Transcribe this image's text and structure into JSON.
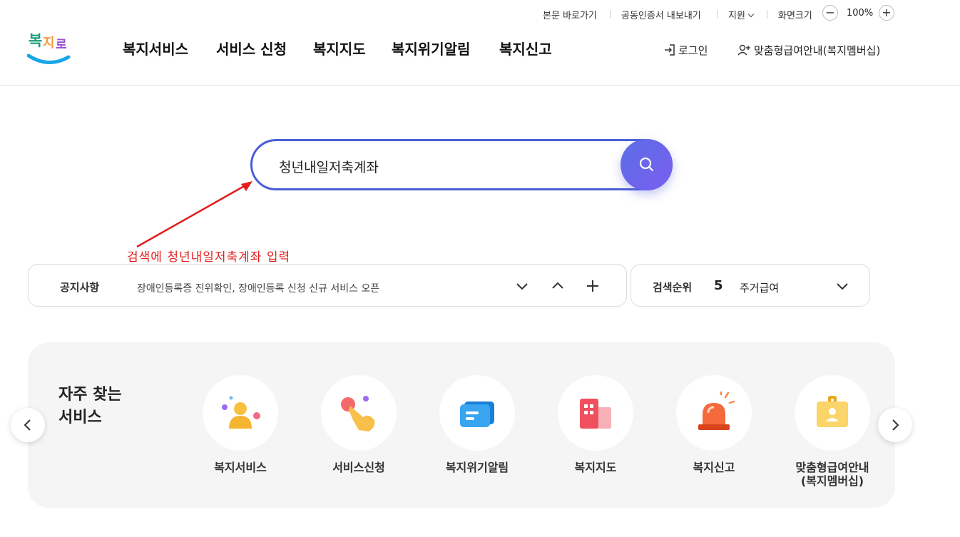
{
  "utility": {
    "skip_link": "본문 바로가기",
    "cert_export": "공동인증서 내보내기",
    "support": "지원",
    "screen_size": "화면크기",
    "zoom_minus": "−",
    "zoom_value": "100%",
    "zoom_plus": "+"
  },
  "header": {
    "logo": "복지로",
    "nav": [
      "복지서비스",
      "서비스 신청",
      "복지지도",
      "복지위기알림",
      "복지신고"
    ],
    "login": "로그인",
    "member": "맞춤형급여안내(복지멤버십)"
  },
  "search": {
    "value": "청년내일저축계좌"
  },
  "annotation": {
    "text": "검색에 청년내일저축계좌 입력",
    "color": "#e31c1c"
  },
  "notice": {
    "label": "공지사항",
    "text": "장애인등록증 진위확인, 장애인등록 신청 신규 서비스 오픈"
  },
  "rank": {
    "label": "검색순위",
    "number": "5",
    "term": "주거급여"
  },
  "frequent": {
    "title_line1": "자주 찾는",
    "title_line2": "서비스",
    "items": [
      {
        "label": "복지서비스",
        "icon": "person-icon"
      },
      {
        "label": "서비스신청",
        "icon": "hand-tap-icon"
      },
      {
        "label": "복지위기알림",
        "icon": "message-icon"
      },
      {
        "label": "복지지도",
        "icon": "building-icon"
      },
      {
        "label": "복지신고",
        "icon": "siren-icon"
      },
      {
        "label": "맞춤형급여안내\n(복지멤버십)",
        "label_line1": "맞춤형급여안내",
        "label_line2": "(복지멤버십)",
        "icon": "id-card-icon"
      }
    ]
  },
  "colors": {
    "accent": "#4a5fd6",
    "search_button": "#6a66ec"
  }
}
